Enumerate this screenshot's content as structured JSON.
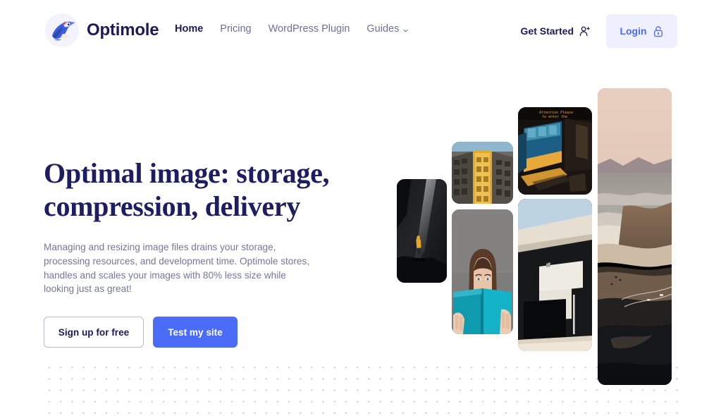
{
  "brand": {
    "name": "Optimole",
    "logo_icon": "optimole-mole-logo-icon"
  },
  "nav": {
    "items": [
      {
        "label": "Home",
        "active": true,
        "has_dropdown": false
      },
      {
        "label": "Pricing",
        "active": false,
        "has_dropdown": false
      },
      {
        "label": "WordPress Plugin",
        "active": false,
        "has_dropdown": false
      },
      {
        "label": "Guides",
        "active": false,
        "has_dropdown": true
      }
    ],
    "dropdown_icon": "chevron-down-icon"
  },
  "header_actions": {
    "get_started_label": "Get Started",
    "get_started_icon": "user-plus-icon",
    "login_label": "Login",
    "login_icon": "lock-icon"
  },
  "hero": {
    "title": "Optimal image: storage, compression, delivery",
    "subtitle": "Managing and resizing image files drains your storage, processing resources, and development time. Optimole stores, handles and scales your images with 80% less size while looking just as great!",
    "primary_cta": "Test my site",
    "secondary_cta": "Sign up for free"
  },
  "collage": {
    "images": [
      {
        "name": "hiker-in-cave-photo",
        "alt": "Person in yellow jacket walking inside a dark cave"
      },
      {
        "name": "yellow-building-facade-photo",
        "alt": "Upward view of a building facade with yellow highlighted section"
      },
      {
        "name": "train-station-photo",
        "alt": "Blue and yellow train at a station platform at night"
      },
      {
        "name": "woman-reading-book-photo",
        "alt": "Woman holding a teal book covering the lower half of her face"
      },
      {
        "name": "modern-architecture-photo",
        "alt": "Minimalist white concrete architecture against blue sky"
      },
      {
        "name": "coastal-road-photo",
        "alt": "Aerial view of a coastal road beside cliffs at dusk"
      }
    ]
  },
  "colors": {
    "accent": "#4a6cf7",
    "heading": "#1d1d63",
    "body_text": "#76769c",
    "nav_inactive": "#6f6f9b",
    "login_bg": "#eef0fd",
    "dot_grid": "#c9c9d4"
  }
}
